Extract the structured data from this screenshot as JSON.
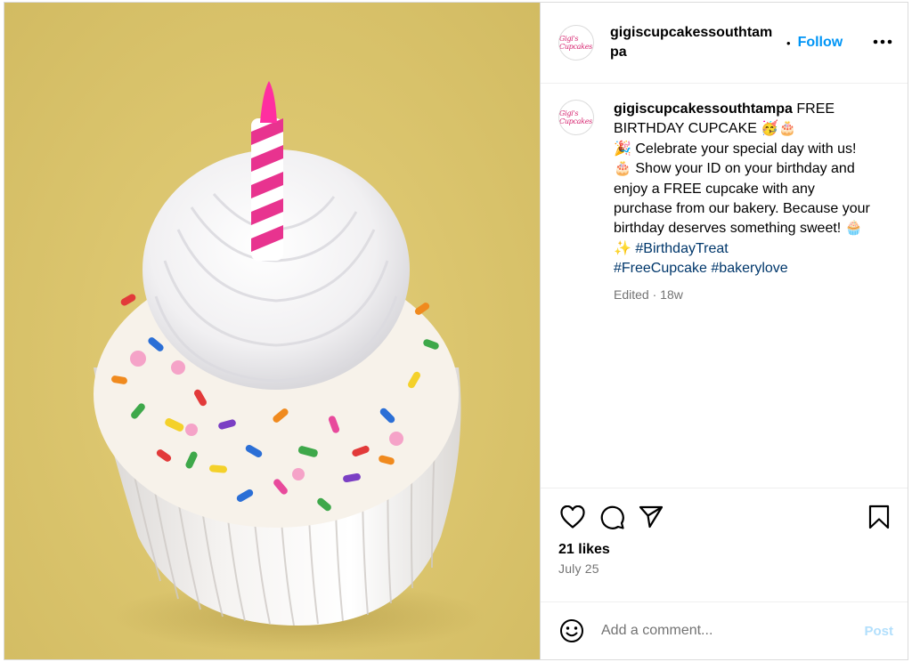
{
  "post": {
    "image_alt": "Vanilla cupcake with white swirl frosting, rainbow sprinkles and a pink striped birthday candle",
    "avatar": {
      "text": "Gigi's Cupcakes"
    },
    "header": {
      "username": "gigiscupcakessouthtampa",
      "separator": "•",
      "follow_label": "Follow",
      "more_icon": "more-horizontal-icon"
    },
    "caption": {
      "username": "gigiscupcakessouthtampa",
      "line1": " FREE BIRTHDAY CUPCAKE 🥳🎂",
      "body": "🎉 Celebrate your special day with us! 🎂 Show your ID on your birthday and enjoy a FREE cupcake with any purchase from our bakery. Because your birthday deserves something sweet! 🧁✨ ",
      "hashtag1": "#BirthdayTreat",
      "hashtag2": "#FreeCupcake",
      "hashtag3": "#bakerylove",
      "edited": "Edited",
      "meta_sep": " · ",
      "time": "18w"
    },
    "actions": {
      "like_icon": "heart-icon",
      "comment_icon": "comment-icon",
      "share_icon": "paper-plane-icon",
      "save_icon": "bookmark-icon"
    },
    "likes": "21 likes",
    "date": "July 25",
    "comment": {
      "placeholder": "Add a comment...",
      "post_label": "Post",
      "emoji_icon": "smiley-icon"
    }
  },
  "colors": {
    "accent": "#0095f6",
    "hashtag": "#00376b",
    "muted": "#737373",
    "post_disabled": "#b2dffc",
    "background_photo": "#dcc66f"
  }
}
